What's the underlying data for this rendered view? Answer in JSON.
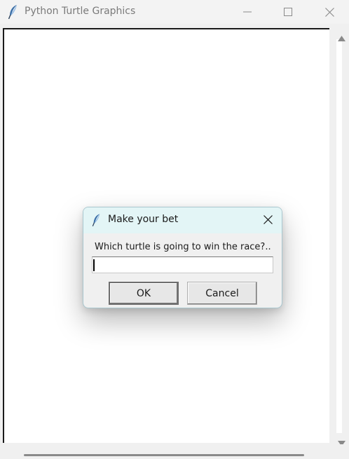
{
  "window": {
    "title": "Python Turtle Graphics",
    "icons": {
      "app": "feather-icon",
      "minimize": "minimize-icon",
      "maximize": "maximize-icon",
      "close": "close-icon"
    }
  },
  "dialog": {
    "title": "Make your bet",
    "prompt": "Which turtle is going to win the race?..",
    "input_value": "",
    "ok_label": "OK",
    "cancel_label": "Cancel",
    "icons": {
      "app": "feather-icon",
      "close": "close-icon"
    }
  },
  "colors": {
    "dialog_titlebar": "#e3f5f6",
    "canvas": "#ffffff",
    "chrome": "#f0f0f0"
  }
}
